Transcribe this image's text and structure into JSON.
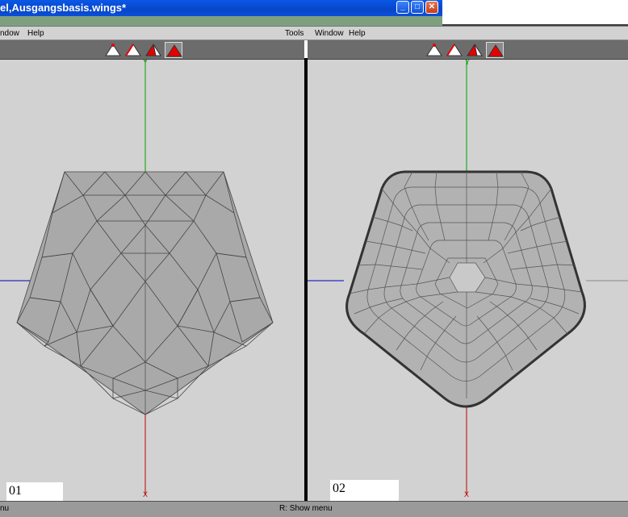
{
  "window": {
    "title": "el,Ausgangsbasis.wings*",
    "minimize_glyph": "_",
    "maximize_glyph": "□",
    "close_glyph": "✕"
  },
  "menubar": {
    "left_items": [
      "ndow",
      "Help"
    ],
    "right_items": [
      "Tools",
      "Window",
      "Help"
    ]
  },
  "toolbar": {
    "modes": [
      "vertex-select",
      "edge-select",
      "face-select",
      "body-select"
    ],
    "selected_mode": "body-select",
    "accent_color": "#e60000"
  },
  "viewports": {
    "left": {
      "label": "01",
      "axis_y": "Y",
      "axis_x": "X",
      "mesh": "flat triangulated pentagon"
    },
    "right": {
      "label": "02",
      "axis_y": "Y",
      "axis_x": "X",
      "mesh": "smoothed subdivided pentagon"
    }
  },
  "status": {
    "left_text": "nu",
    "center_text": "R: Show menu"
  },
  "colors": {
    "viewport_bg": "#d2d2d2",
    "mesh_fill": "#a8a8a8",
    "axis_y": "#00a000",
    "axis_x": "#c00000",
    "axis_z": "#0000c0"
  }
}
